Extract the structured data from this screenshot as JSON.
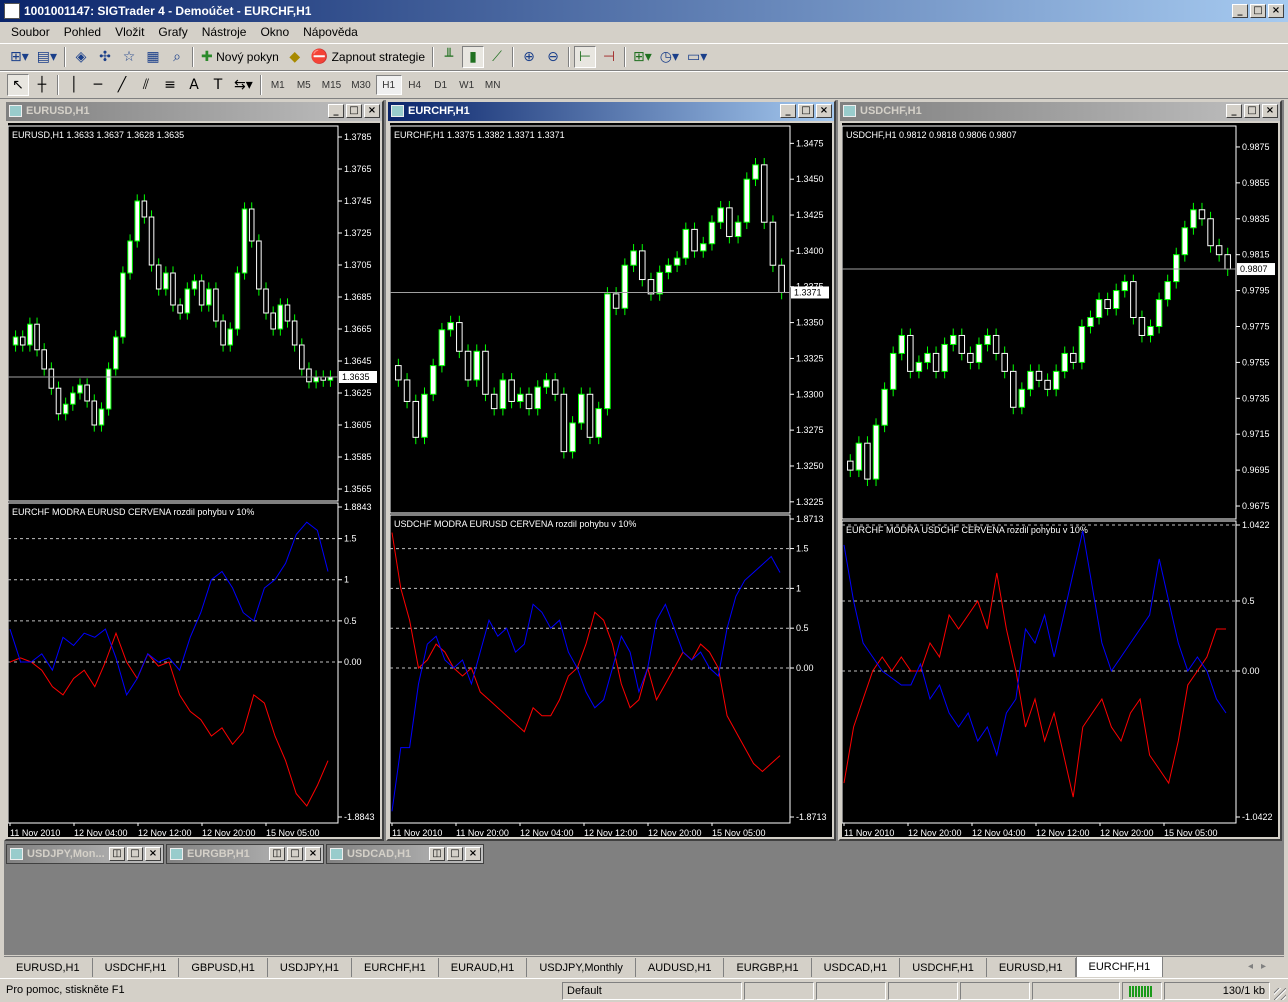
{
  "window": {
    "title": "1001001147: SIGTrader 4 - Demoúčet - EURCHF,H1"
  },
  "menu": [
    "Soubor",
    "Pohled",
    "Vložit",
    "Grafy",
    "Nástroje",
    "Okno",
    "Nápověda"
  ],
  "toolbar": {
    "new_order": "Nový pokyn",
    "start_strategy": "Zapnout strategie"
  },
  "timeframes": [
    "M1",
    "M5",
    "M15",
    "M30",
    "H1",
    "H4",
    "D1",
    "W1",
    "MN"
  ],
  "selected_timeframe": "H1",
  "indicator_label": {
    "a": "EURCHF MODRA",
    "b": "EURUSD CERVENA",
    "c": "rozdil pohybu v 10%"
  },
  "colors": {
    "bull": "#ffffff",
    "bear": "#ffffff",
    "wick": "#00ff00",
    "blue_line": "#0000ff",
    "red_line": "#ff0000",
    "axis": "#ffffff",
    "active_title": "#0a246a"
  },
  "charts": [
    {
      "title": "EURUSD,H1",
      "active": false,
      "ohlc_header": "EURUSD,H1  1.3633 1.3637 1.3628 1.3635",
      "price_ticks": [
        "1.3785",
        "1.3765",
        "1.3745",
        "1.3725",
        "1.3705",
        "1.3685",
        "1.3665",
        "1.3645",
        "1.3625",
        "1.3605",
        "1.3585",
        "1.3565"
      ],
      "price_range": [
        1.356,
        1.379
      ],
      "current_price": "1.3635",
      "current_price_value": 1.3635,
      "start_price": 1.3655,
      "closes": [
        1.366,
        1.3655,
        1.3668,
        1.3652,
        1.364,
        1.3628,
        1.3612,
        1.3618,
        1.3625,
        1.363,
        1.362,
        1.3605,
        1.3615,
        1.364,
        1.366,
        1.37,
        1.372,
        1.3745,
        1.3735,
        1.3705,
        1.369,
        1.37,
        1.368,
        1.3675,
        1.369,
        1.3695,
        1.368,
        1.369,
        1.367,
        1.3655,
        1.3665,
        1.37,
        1.374,
        1.372,
        1.369,
        1.3675,
        1.3665,
        1.368,
        1.367,
        1.3655,
        1.364,
        1.3632,
        1.3635,
        1.3633,
        1.3635
      ],
      "indicator": {
        "header_a": "EURCHF MODRA",
        "header_b": "EURUSD CERVENA",
        "header_c": "rozdil pohybu v 10%",
        "ticks": [
          "1.8843",
          "1.5",
          "1",
          "0.5",
          "0.00",
          "-1.8843"
        ],
        "range": [
          -1.8843,
          1.8843
        ],
        "dashed_levels": [
          1.5,
          1.0,
          0.5,
          0.0
        ],
        "blue": [
          0.4,
          0.0,
          0.0,
          0.1,
          -0.1,
          0.3,
          0.2,
          0.35,
          0.3,
          0.4,
          0.05,
          -0.4,
          -0.2,
          0.1,
          0.0,
          0.05,
          -0.1,
          0.3,
          0.6,
          1.0,
          1.1,
          0.9,
          0.6,
          0.5,
          0.9,
          1.0,
          1.2,
          1.55,
          1.7,
          1.6,
          1.1
        ],
        "red": [
          0.0,
          0.05,
          0.0,
          -0.1,
          -0.3,
          -0.4,
          -0.2,
          -0.1,
          -0.3,
          0.0,
          0.35,
          0.0,
          -0.2,
          0.1,
          -0.05,
          0.0,
          -0.4,
          -0.6,
          -0.7,
          -0.9,
          -0.8,
          -1.0,
          -0.85,
          -0.4,
          -0.5,
          -0.9,
          -1.2,
          -1.6,
          -1.75,
          -1.5,
          -1.2
        ]
      },
      "time_labels": [
        "11 Nov 2010",
        "12 Nov 04:00",
        "12 Nov 12:00",
        "12 Nov 20:00",
        "15 Nov 05:00"
      ]
    },
    {
      "title": "EURCHF,H1",
      "active": true,
      "ohlc_header": "EURCHF,H1  1.3375 1.3382 1.3371 1.3371",
      "price_ticks": [
        "1.3475",
        "1.3450",
        "1.3425",
        "1.3400",
        "1.3375",
        "1.3350",
        "1.3325",
        "1.3300",
        "1.3275",
        "1.3250",
        "1.3225"
      ],
      "price_range": [
        1.322,
        1.3485
      ],
      "current_price": "1.3371",
      "current_price_value": 1.3371,
      "start_price": 1.332,
      "closes": [
        1.331,
        1.3295,
        1.327,
        1.33,
        1.332,
        1.3345,
        1.335,
        1.333,
        1.331,
        1.333,
        1.33,
        1.329,
        1.331,
        1.3295,
        1.33,
        1.329,
        1.3305,
        1.331,
        1.33,
        1.326,
        1.328,
        1.33,
        1.327,
        1.329,
        1.337,
        1.336,
        1.339,
        1.34,
        1.338,
        1.337,
        1.3385,
        1.339,
        1.3395,
        1.3415,
        1.34,
        1.3405,
        1.342,
        1.343,
        1.341,
        1.342,
        1.345,
        1.346,
        1.342,
        1.339,
        1.3371
      ],
      "indicator": {
        "header_a": "USDCHF MODRA",
        "header_b": "EURUSD CERVENA",
        "header_c": "rozdil pohybu v 10%",
        "ticks": [
          "1.8713",
          "1.5",
          "1",
          "0.5",
          "0.00",
          "-1.8713"
        ],
        "range": [
          -1.8713,
          1.8713
        ],
        "dashed_levels": [
          1.5,
          1.0,
          0.5,
          0.0
        ],
        "blue": [
          -1.8,
          -1.0,
          -1.0,
          -0.2,
          0.3,
          0.4,
          0.1,
          0.0,
          0.1,
          -0.2,
          0.2,
          0.6,
          0.4,
          0.5,
          0.2,
          0.3,
          0.8,
          0.7,
          0.5,
          0.6,
          0.2,
          0.0,
          -0.3,
          -0.5,
          -0.4,
          0.0,
          0.4,
          0.2,
          -0.3,
          0.0,
          0.6,
          0.8,
          0.5,
          0.2,
          0.1,
          0.2,
          0.0,
          -0.1,
          0.5,
          0.9,
          1.1,
          1.2,
          1.3,
          1.4,
          1.2
        ],
        "red": [
          1.7,
          1.0,
          0.6,
          0.0,
          0.1,
          0.3,
          0.2,
          0.0,
          -0.1,
          0.0,
          -0.3,
          -0.4,
          -0.5,
          -0.6,
          -0.7,
          -0.8,
          -0.5,
          -0.6,
          -0.6,
          -0.4,
          -0.1,
          0.0,
          0.3,
          0.7,
          0.6,
          0.3,
          -0.2,
          -0.5,
          -0.4,
          0.0,
          -0.4,
          -0.2,
          0.0,
          0.2,
          0.1,
          0.3,
          0.2,
          0.0,
          -0.6,
          -0.8,
          -1.0,
          -1.2,
          -1.3,
          -1.2,
          -1.1
        ]
      },
      "time_labels": [
        "11 Nov 2010",
        "11 Nov 20:00",
        "12 Nov 04:00",
        "12 Nov 12:00",
        "12 Nov 20:00",
        "15 Nov 05:00"
      ]
    },
    {
      "title": "USDCHF,H1",
      "active": false,
      "ohlc_header": "USDCHF,H1  0.9812 0.9818 0.9806 0.9807",
      "price_ticks": [
        "0.9875",
        "0.9855",
        "0.9835",
        "0.9815",
        "0.9795",
        "0.9775",
        "0.9755",
        "0.9735",
        "0.9715",
        "0.9695",
        "0.9675"
      ],
      "price_range": [
        0.967,
        0.9885
      ],
      "current_price": "0.9807",
      "current_price_value": 0.9807,
      "start_price": 0.97,
      "closes": [
        0.9695,
        0.971,
        0.969,
        0.972,
        0.974,
        0.976,
        0.977,
        0.975,
        0.9755,
        0.976,
        0.975,
        0.9765,
        0.977,
        0.976,
        0.9755,
        0.9765,
        0.977,
        0.976,
        0.975,
        0.973,
        0.974,
        0.975,
        0.9745,
        0.974,
        0.975,
        0.976,
        0.9755,
        0.9775,
        0.978,
        0.979,
        0.9785,
        0.9795,
        0.98,
        0.978,
        0.977,
        0.9775,
        0.979,
        0.98,
        0.9815,
        0.983,
        0.984,
        0.9835,
        0.982,
        0.9815,
        0.9807
      ],
      "indicator": {
        "header_a": "EURCHF MODRA",
        "header_b": "USDCHF CERVENA",
        "header_c": "rozdil pohybu v 10%",
        "ticks": [
          "1.0422",
          "0.5",
          "0.00",
          "-1.0422"
        ],
        "range": [
          -1.0422,
          1.0422
        ],
        "dashed_levels": [
          1.0422,
          0.5,
          0.0
        ],
        "blue": [
          0.9,
          0.5,
          0.2,
          0.1,
          0.0,
          -0.05,
          -0.1,
          -0.1,
          0.05,
          -0.2,
          -0.1,
          -0.3,
          -0.4,
          -0.3,
          -0.5,
          -0.4,
          -0.6,
          -0.3,
          -0.2,
          0.3,
          0.2,
          0.4,
          0.1,
          0.4,
          0.7,
          1.0,
          0.6,
          0.2,
          0.0,
          0.1,
          0.2,
          0.3,
          0.4,
          0.8,
          0.5,
          0.2,
          0.0,
          0.1,
          0.0,
          -0.2,
          -0.3
        ],
        "red": [
          -0.8,
          -0.4,
          -0.2,
          0.0,
          0.1,
          0.0,
          0.1,
          0.0,
          0.0,
          0.2,
          0.1,
          0.4,
          0.3,
          0.4,
          0.5,
          0.3,
          0.7,
          0.3,
          0.0,
          -0.4,
          -0.2,
          -0.5,
          -0.3,
          -0.6,
          -0.9,
          -0.4,
          -0.3,
          -0.2,
          -0.4,
          -0.5,
          -0.3,
          -0.2,
          -0.6,
          -0.7,
          -0.8,
          -0.5,
          -0.1,
          0.0,
          0.1,
          0.3,
          0.3
        ]
      },
      "time_labels": [
        "11 Nov 2010",
        "12 Nov 20:00",
        "12 Nov 04:00",
        "12 Nov 12:00",
        "12 Nov 20:00",
        "15 Nov 05:00"
      ]
    }
  ],
  "minimized": [
    {
      "title": "USDJPY,Mon..."
    },
    {
      "title": "EURGBP,H1"
    },
    {
      "title": "USDCAD,H1"
    }
  ],
  "tabs": [
    "EURUSD,H1",
    "USDCHF,H1",
    "GBPUSD,H1",
    "USDJPY,H1",
    "EURCHF,H1",
    "EURAUD,H1",
    "USDJPY,Monthly",
    "AUDUSD,H1",
    "EURGBP,H1",
    "USDCAD,H1",
    "USDCHF,H1",
    "EURUSD,H1",
    "EURCHF,H1"
  ],
  "active_tab": 12,
  "status": {
    "help": "Pro pomoc, stiskněte F1",
    "profile": "Default",
    "traffic": "130/1 kb"
  }
}
